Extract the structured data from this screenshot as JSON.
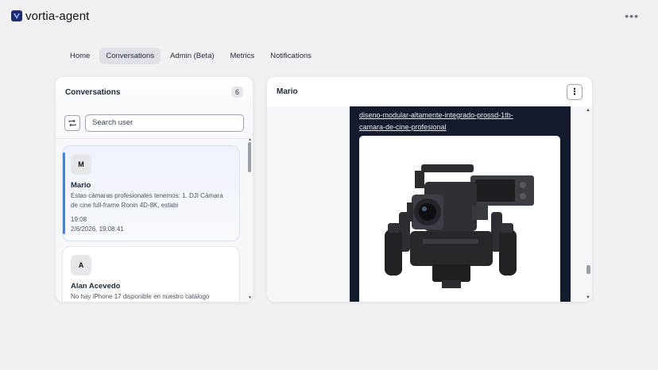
{
  "app": {
    "title": "vortia-agent",
    "logo_icon": "v-logo-icon",
    "menu_icon": "more-horizontal-icon"
  },
  "nav": {
    "tabs": [
      {
        "label": "Home",
        "active": false
      },
      {
        "label": "Conversations",
        "active": true
      },
      {
        "label": "Admin (Beta)",
        "active": false
      },
      {
        "label": "Metrics",
        "active": false
      },
      {
        "label": "Notifications",
        "active": false
      }
    ]
  },
  "conversations": {
    "title": "Conversations",
    "count": "6",
    "search": {
      "placeholder": "Search user",
      "value": ""
    },
    "items": [
      {
        "initial": "M",
        "name": "Mario",
        "preview": "Estas cámaras profesionales tenemos: 1. DJI Cámara de cine full-frame Ronin 4D-8K, estabi",
        "time": "19:08",
        "datetime": "2/6/2026, 19:08:41",
        "selected": true
      },
      {
        "initial": "A",
        "name": "Alan Acevedo",
        "preview": "No hay iPhone 17 disponible en nuestro catálogo",
        "selected": false
      }
    ]
  },
  "chat": {
    "title": "Mario",
    "menu_icon": "more-vertical-icon",
    "message": {
      "link_line1": "diseno-modular-altamente-integrado-prossd-1tb-",
      "link_line2": "camara-de-cine-profesional",
      "image_icon": "cinema-camera-image"
    }
  },
  "colors": {
    "accent": "#4c7fd9",
    "bubble": "#141b2d",
    "background": "#f1f1f3"
  }
}
